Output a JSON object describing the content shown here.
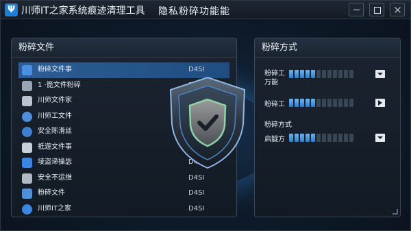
{
  "window": {
    "app_title": "川师IT之家系统痕迹清理工具",
    "center_title": "隐私粉碎功能能",
    "logo_glyph": "Ψ"
  },
  "left_panel": {
    "title": "粉碎文件",
    "rows": [
      {
        "name": "粉碎文件事",
        "value": "D4SI",
        "icon": "shield-icon",
        "color": "#4a90e2",
        "selected": true
      },
      {
        "name": "1 ·箆文件粉碎",
        "value": "D4SI",
        "icon": "file-stack-icon",
        "color": "#9aa6b4",
        "selected": false
      },
      {
        "name": "川师文件家",
        "value": "",
        "icon": "hand-icon",
        "color": "#b9c3cf",
        "selected": false
      },
      {
        "name": "川师工文件",
        "value": "",
        "icon": "cloud-icon",
        "color": "#4f8ed8",
        "selected": false
      },
      {
        "name": "安全陈滑丝",
        "value": "",
        "icon": "cloud-icon",
        "color": "#3f7fcf",
        "selected": false
      },
      {
        "name": "祗遊文件事",
        "value": "",
        "icon": "document-icon",
        "color": "#c8d0da",
        "selected": false
      },
      {
        "name": "堎盗谛操毖",
        "value": "D4SI",
        "icon": "shield-icon",
        "color": "#3a86e0",
        "selected": false
      },
      {
        "name": "安全不运维",
        "value": "D4SI",
        "icon": "wrench-icon",
        "color": "#b0bac6",
        "selected": false
      },
      {
        "name": "粉碎文件",
        "value": "D4SI",
        "icon": "link-icon",
        "color": "#4f8ed8",
        "selected": false
      },
      {
        "name": "川师IT之家",
        "value": "D4SI",
        "icon": "check-circle-icon",
        "color": "#3a86e0",
        "selected": false
      }
    ]
  },
  "right_panel": {
    "title": "粉碎方式",
    "options": [
      {
        "label_line1": "粉碎工",
        "label_line2": "万能",
        "level": 0.45,
        "control": "dropdown"
      },
      {
        "label_line1": "粉碎工",
        "label_line2": "",
        "level": 0.45,
        "control": "play"
      },
      {
        "label_line1": "粉碎方式",
        "label_line2": "",
        "level": null,
        "control": "none"
      },
      {
        "label_line1": "启靛方",
        "label_line2": "",
        "level": 0.45,
        "control": "dropdown"
      }
    ]
  },
  "colors": {
    "accent": "#2f7fcb",
    "selected_row": "#2d5d94",
    "shield_green": "#8fd4a8"
  }
}
